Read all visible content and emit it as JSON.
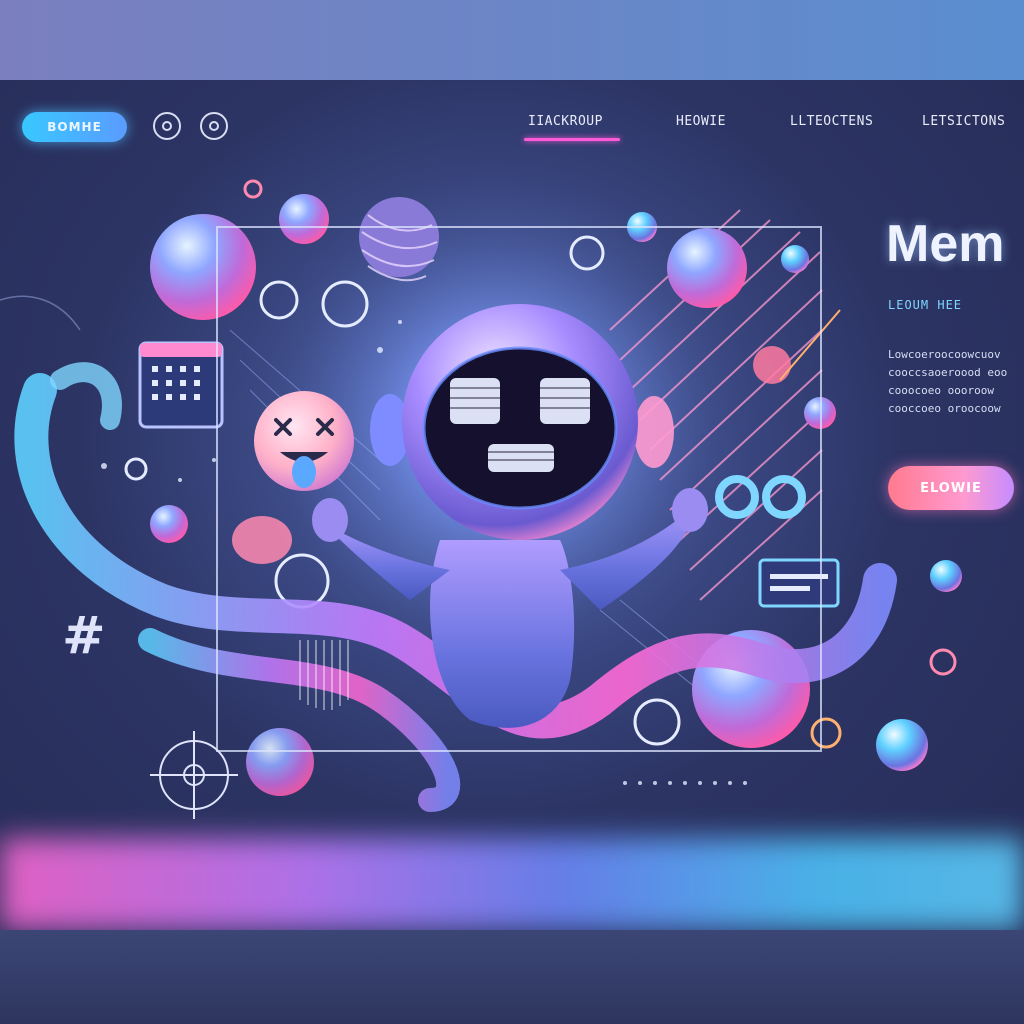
{
  "nav": {
    "pill_label": "ВОМНЕ",
    "links": [
      "IIACKROUP",
      "HEOWIE",
      "LLTEOCTENS",
      "LETSICTONS"
    ]
  },
  "hero": {
    "title": "Mem",
    "subtitle": "LEOUM HEE",
    "body_lines": [
      "Lowcoeroocoowcuov",
      "cooccsaoeroood eoo",
      "cooocoeo oooroow",
      "cooccoeo oroocoow"
    ],
    "cta_label": "ELOWIE"
  },
  "decor": {
    "hashtag": "#"
  },
  "colors": {
    "accent_pink": "#ff5ad8",
    "accent_cyan": "#38c8ff",
    "text_light": "#eef3ff"
  }
}
